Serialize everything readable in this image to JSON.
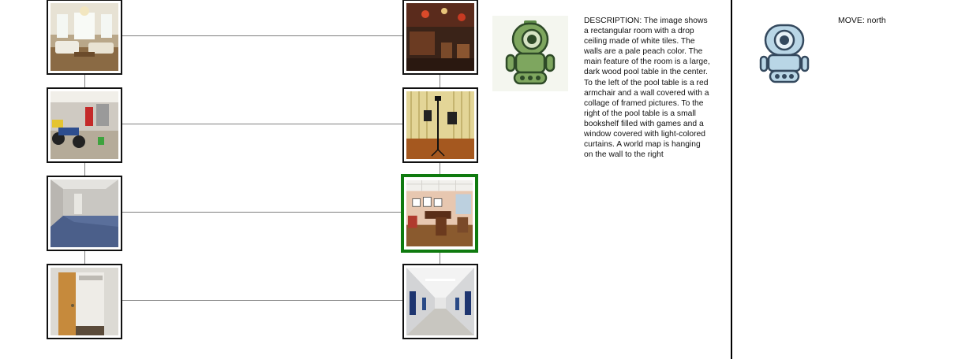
{
  "map": {
    "rooms": [
      {
        "id": "room-living",
        "scene": "living room with white chandelier and sofas",
        "current": false
      },
      {
        "id": "room-bar",
        "scene": "pub with dark wood bar and red lights",
        "current": false
      },
      {
        "id": "room-garage",
        "scene": "garage with motorcycles and red toolbox",
        "current": false
      },
      {
        "id": "room-studio",
        "scene": "music studio with curtains and speakers",
        "current": false
      },
      {
        "id": "room-hall-empty",
        "scene": "empty room with blue carpet",
        "current": false
      },
      {
        "id": "room-pool",
        "scene": "room with wooden pool table",
        "current": true
      },
      {
        "id": "room-closet",
        "scene": "doorway to a small closet",
        "current": false
      },
      {
        "id": "room-corridor",
        "scene": "long school corridor",
        "current": false
      }
    ],
    "current_color": "#0f7a0f"
  },
  "observation": {
    "description": "DESCRIPTION: The image shows a rectangular room with a drop ceiling made of white tiles. The walls are a pale peach color. The main feature of the room is a large, dark wood pool table in the center. To the left of the pool table is a red armchair and a wall covered with a collage of framed pictures. To the right of the pool table is a small bookshelf filled with games and a window covered with light-colored curtains. A world map is hanging on the wall to the right",
    "agent_icon": "robot-icon",
    "agent_color": "#6b9a52"
  },
  "action": {
    "move": "MOVE: north",
    "agent_icon": "robot-icon",
    "agent_color": "#b9d6e6"
  }
}
